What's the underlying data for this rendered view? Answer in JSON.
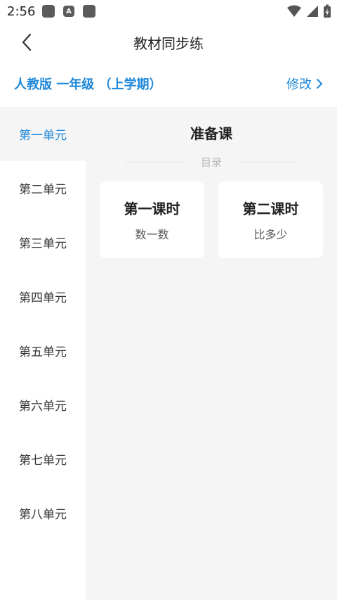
{
  "status_bar": {
    "time": "2:56",
    "app_icon_b_letter": "A"
  },
  "header": {
    "title": "教材同步练"
  },
  "edition": {
    "label": "人教版 一年级 （上学期）",
    "edit_label": "修改"
  },
  "sidebar": {
    "items": [
      {
        "label": "第一单元",
        "active": true
      },
      {
        "label": "第二单元",
        "active": false
      },
      {
        "label": "第三单元",
        "active": false
      },
      {
        "label": "第四单元",
        "active": false
      },
      {
        "label": "第五单元",
        "active": false
      },
      {
        "label": "第六单元",
        "active": false
      },
      {
        "label": "第七单元",
        "active": false
      },
      {
        "label": "第八单元",
        "active": false
      }
    ]
  },
  "content": {
    "section_title": "准备课",
    "catalog_label": "目录",
    "lessons": [
      {
        "title": "第一课时",
        "subtitle": "数一数"
      },
      {
        "title": "第二课时",
        "subtitle": "比多少"
      }
    ]
  },
  "colors": {
    "accent": "#1e88d8",
    "panel_bg": "#f5f5f5"
  },
  "icons": {
    "back": "back-arrow-icon",
    "chevron": "chevron-right-icon",
    "wifi": "wifi-icon",
    "signal": "signal-icon",
    "battery": "battery-charging-icon"
  }
}
